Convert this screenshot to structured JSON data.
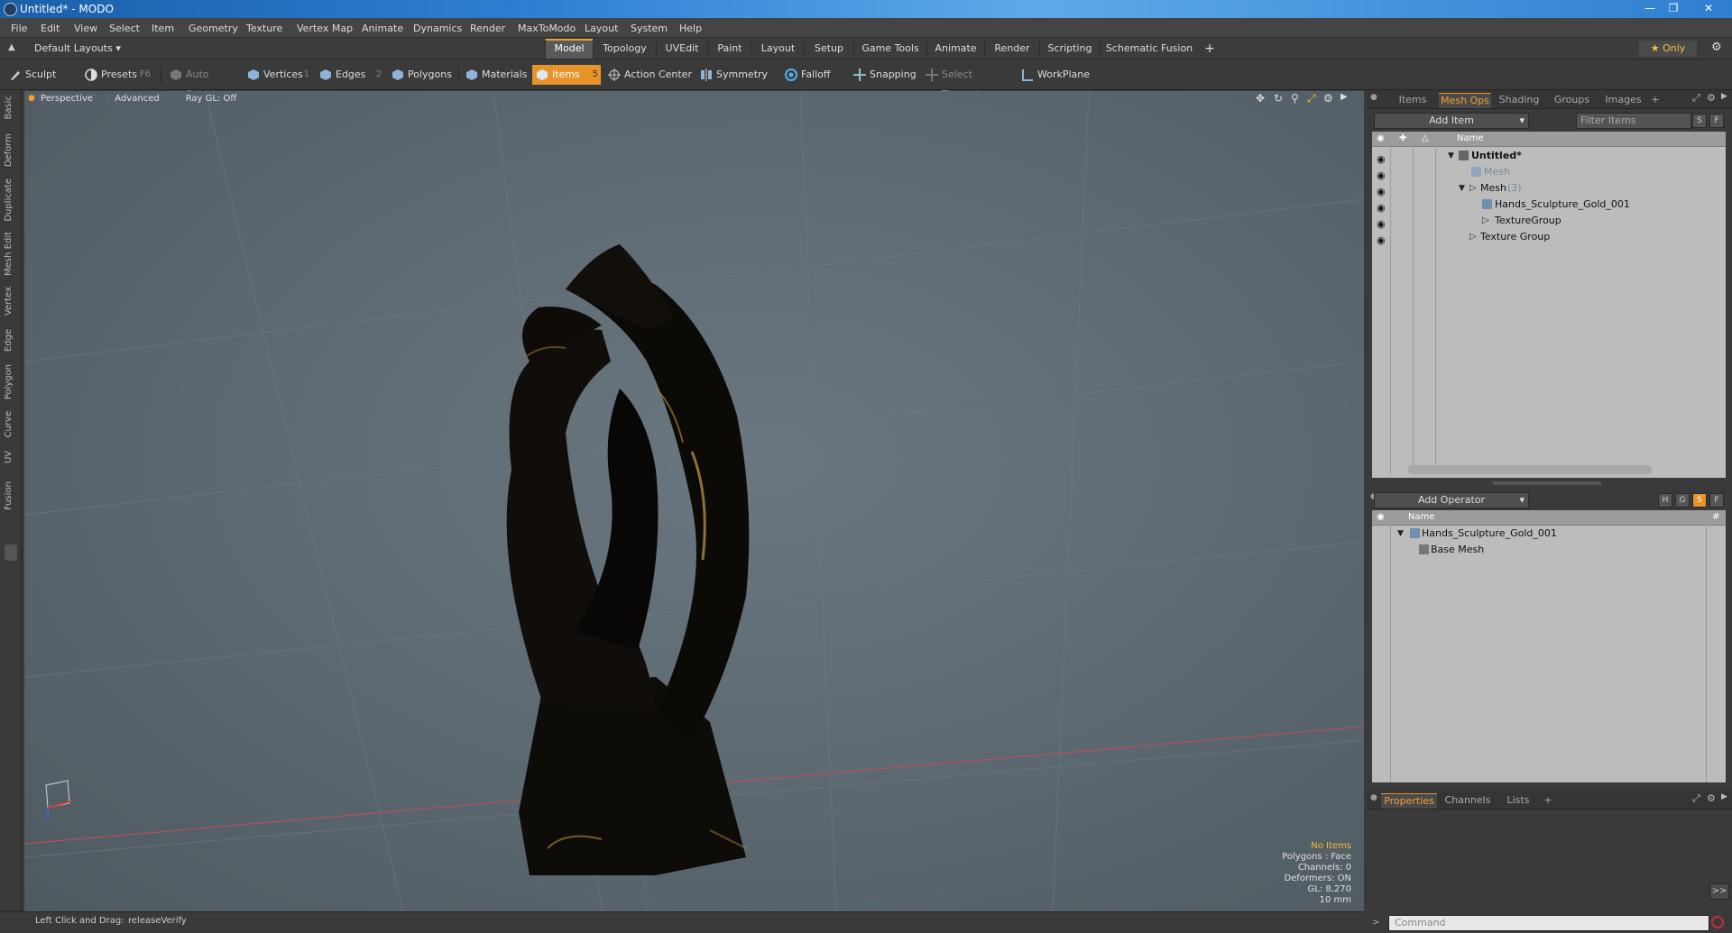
{
  "window": {
    "title": "Untitled* - MODO"
  },
  "menu": [
    "File",
    "Edit",
    "View",
    "Select",
    "Item",
    "Geometry",
    "Texture",
    "Vertex Map",
    "Animate",
    "Dynamics",
    "Render",
    "MaxToModo",
    "Layout",
    "System",
    "Help"
  ],
  "layout_selector": "Default Layouts",
  "layout_tabs": [
    "Model",
    "Topology",
    "UVEdit",
    "Paint",
    "Layout",
    "Setup",
    "Game Tools",
    "Animate",
    "Render",
    "Scripting",
    "Schematic Fusion"
  ],
  "layout_tab_add": "+",
  "only_button": "Only",
  "toolbar": {
    "sculpt": "Sculpt",
    "presets": "Presets",
    "presets_key": "F6",
    "auto_select": "Auto Select",
    "vertices": "Vertices",
    "vertices_key": "1",
    "edges": "Edges",
    "edges_key": "2",
    "polygons": "Polygons",
    "materials": "Materials",
    "items": "Items",
    "items_key": "5",
    "action_center": "Action Center",
    "symmetry": "Symmetry",
    "falloff": "Falloff",
    "snapping": "Snapping",
    "select_through": "Select Through",
    "workplane": "WorkPlane"
  },
  "left_tabs": [
    "Basic",
    "Deform",
    "Duplicate",
    "Mesh Edit",
    "Vertex",
    "Edge",
    "Polygon",
    "Curve",
    "UV",
    "Fusion"
  ],
  "viewport": {
    "view_mode": "Perspective",
    "shading": "Advanced",
    "raygl": "Ray GL: Off",
    "info": {
      "items": "No Items",
      "polygons": "Polygons : Face",
      "channels": "Channels: 0",
      "deformers": "Deformers: ON",
      "gl": "GL: 8,270",
      "unit": "10 mm"
    }
  },
  "status_bar": {
    "hint": "Left Click and Drag:",
    "action": "releaseVerify"
  },
  "items_panel": {
    "tabs": [
      "Items",
      "Mesh Ops",
      "Shading",
      "Groups",
      "Images"
    ],
    "active_tab": "Mesh Ops",
    "add_item": "Add Item",
    "filter_placeholder": "Filter Items",
    "btn_s": "S",
    "btn_f": "F",
    "col_name": "Name",
    "rows": [
      {
        "label": "Untitled*",
        "style": "bold"
      },
      {
        "label": "Mesh",
        "style": "dim"
      },
      {
        "label": "Mesh",
        "count": "(3)",
        "style": "normal"
      },
      {
        "label": "Hands_Sculpture_Gold_001",
        "style": "normal"
      },
      {
        "label": "TextureGroup",
        "style": "normal"
      },
      {
        "label": "Texture Group",
        "style": "normal"
      }
    ]
  },
  "meshops_panel": {
    "add_operator": "Add Operator",
    "btn_h": "H",
    "btn_g": "G",
    "btn_s": "S",
    "btn_f": "F",
    "col_name": "Name",
    "col_hash": "#",
    "rows": [
      {
        "label": "Hands_Sculpture_Gold_001"
      },
      {
        "label": "Base Mesh"
      }
    ]
  },
  "properties_panel": {
    "tabs": [
      "Properties",
      "Channels",
      "Lists"
    ],
    "add": "+",
    "expand": ">>"
  },
  "command": {
    "placeholder": "Command"
  },
  "colors": {
    "accent": "#e8922a",
    "titlebar": "#2d7ed3",
    "viewport": "#5f6b73",
    "sculpture": "#0d0b08"
  }
}
